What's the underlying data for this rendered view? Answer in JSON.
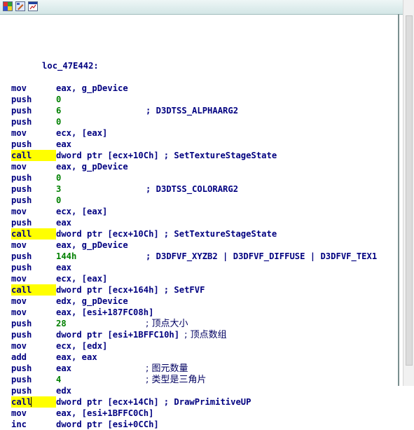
{
  "toolbar": {
    "icons": [
      "color-palette-icon",
      "edit-graph-icon",
      "chart-window-icon"
    ]
  },
  "code": {
    "label": "loc_47E442:",
    "lines": [
      {
        "mnemonic": "mov",
        "highlight": false,
        "operand": "eax, g_pDevice",
        "comment": ""
      },
      {
        "mnemonic": "push",
        "highlight": false,
        "operand": "0",
        "comment": ""
      },
      {
        "mnemonic": "push",
        "highlight": false,
        "operand": "6",
        "comment": "; D3DTSS_ALPHAARG2"
      },
      {
        "mnemonic": "push",
        "highlight": false,
        "operand": "0",
        "comment": ""
      },
      {
        "mnemonic": "mov",
        "highlight": false,
        "operand": "ecx, [eax]",
        "comment": ""
      },
      {
        "mnemonic": "push",
        "highlight": false,
        "operand": "eax",
        "comment": ""
      },
      {
        "mnemonic": "call",
        "highlight": true,
        "operand": "dword ptr [ecx+10Ch]",
        "comment": "; SetTextureStageState"
      },
      {
        "mnemonic": "mov",
        "highlight": false,
        "operand": "eax, g_pDevice",
        "comment": ""
      },
      {
        "mnemonic": "push",
        "highlight": false,
        "operand": "0",
        "comment": ""
      },
      {
        "mnemonic": "push",
        "highlight": false,
        "operand": "3",
        "comment": "; D3DTSS_COLORARG2"
      },
      {
        "mnemonic": "push",
        "highlight": false,
        "operand": "0",
        "comment": ""
      },
      {
        "mnemonic": "mov",
        "highlight": false,
        "operand": "ecx, [eax]",
        "comment": ""
      },
      {
        "mnemonic": "push",
        "highlight": false,
        "operand": "eax",
        "comment": ""
      },
      {
        "mnemonic": "call",
        "highlight": true,
        "operand": "dword ptr [ecx+10Ch]",
        "comment": "; SetTextureStageState"
      },
      {
        "mnemonic": "mov",
        "highlight": false,
        "operand": "eax, g_pDevice",
        "comment": ""
      },
      {
        "mnemonic": "push",
        "highlight": false,
        "operand": "144h",
        "comment": "; D3DFVF_XYZB2 | D3DFVF_DIFFUSE | D3DFVF_TEX1"
      },
      {
        "mnemonic": "push",
        "highlight": false,
        "operand": "eax",
        "comment": ""
      },
      {
        "mnemonic": "mov",
        "highlight": false,
        "operand": "ecx, [eax]",
        "comment": ""
      },
      {
        "mnemonic": "call",
        "highlight": true,
        "operand": "dword ptr [ecx+164h]",
        "comment": "; SetFVF"
      },
      {
        "mnemonic": "mov",
        "highlight": false,
        "operand": "edx, g_pDevice",
        "comment": ""
      },
      {
        "mnemonic": "mov",
        "highlight": false,
        "operand": "eax, [esi+187FC08h]",
        "comment": ""
      },
      {
        "mnemonic": "push",
        "highlight": false,
        "operand": "28",
        "comment": "; 顶点大小"
      },
      {
        "mnemonic": "push",
        "highlight": false,
        "operand": "dword ptr [esi+1BFFC10h]",
        "comment": "; 顶点数组"
      },
      {
        "mnemonic": "mov",
        "highlight": false,
        "operand": "ecx, [edx]",
        "comment": ""
      },
      {
        "mnemonic": "add",
        "highlight": false,
        "operand": "eax, eax",
        "comment": ""
      },
      {
        "mnemonic": "push",
        "highlight": false,
        "operand": "eax",
        "comment": "; 图元数量"
      },
      {
        "mnemonic": "push",
        "highlight": false,
        "operand": "4",
        "comment": "; 类型是三角片"
      },
      {
        "mnemonic": "push",
        "highlight": false,
        "operand": "edx",
        "comment": ""
      },
      {
        "mnemonic": "call",
        "highlight": true,
        "operand": "dword ptr [ecx+14Ch]",
        "comment": "; DrawPrimitiveUP"
      },
      {
        "mnemonic": "mov",
        "highlight": false,
        "operand": "eax, [esi+1BFFC0Ch]",
        "comment": ""
      },
      {
        "mnemonic": "inc",
        "highlight": false,
        "operand": "dword ptr [esi+0CCh]",
        "comment": ""
      }
    ]
  },
  "colors": {
    "mnemonic": "#000080",
    "number": "#008000",
    "highlight": "#ffff00",
    "background": "#ffffff"
  }
}
